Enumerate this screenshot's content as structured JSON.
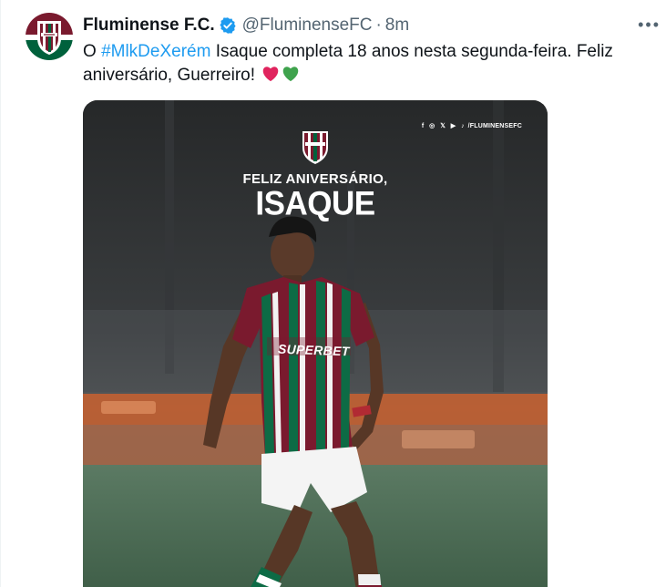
{
  "tweet": {
    "author_name": "Fluminense F.C.",
    "handle": "@FluminenseFC",
    "separator": "·",
    "time": "8m",
    "more_label": "•••",
    "text_prefix": "O ",
    "hashtag": "#MlkDeXerém",
    "text_body": " Isaque completa 18 anos nesta segunda-feira. Feliz aniversário, Guerreiro! ",
    "emoji": [
      "red-heart",
      "green-heart"
    ]
  },
  "media": {
    "social_icons": "f ◎ 𝕏 ▶ ♪",
    "social_handle": "/FLUMINENSEFC",
    "greeting": "FELIZ ANIVERSÁRIO,",
    "player_name": "ISAQUE",
    "shirt_sponsor": "SUPERBET"
  },
  "colors": {
    "hashtag": "#1d9bf0",
    "verified": "#1d9bf0",
    "club_maroon": "#7a1a2e",
    "club_green": "#00613c",
    "heart_red": "#e0245e",
    "heart_green": "#3fa34d"
  }
}
